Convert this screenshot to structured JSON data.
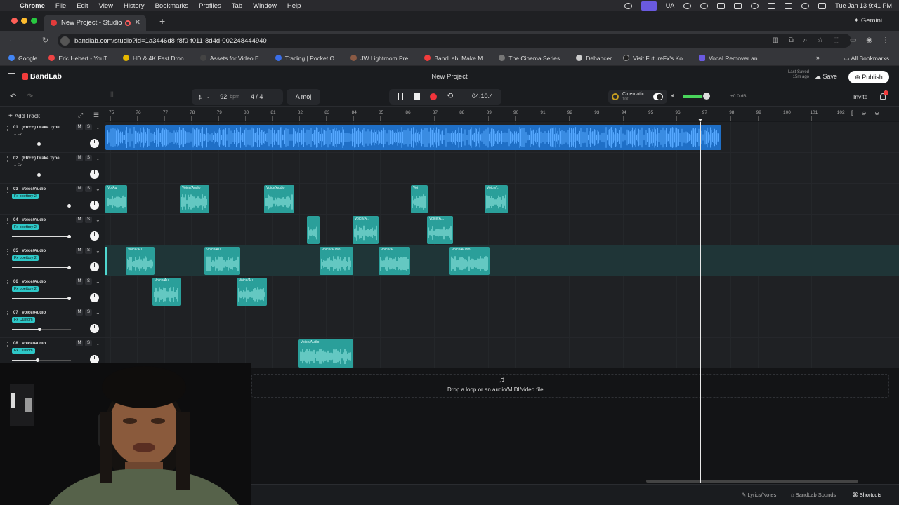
{
  "menubar": {
    "app": "Chrome",
    "items": [
      "File",
      "Edit",
      "View",
      "History",
      "Bookmarks",
      "Profiles",
      "Tab",
      "Window",
      "Help"
    ],
    "lang": "UA",
    "datetime": "Tue Jan 13  9:41 PM"
  },
  "browser": {
    "tab_title": "New Project - Studio",
    "gemini": "Gemini",
    "url": "bandlab.com/studio?id=1a3446d8-f8f0-f011-8d4d-002248444940",
    "bookmarks": [
      "Google",
      "Eric Hebert - YouT...",
      "HD & 4K Fast Dron...",
      "Assets for Video E...",
      "Trading | Pocket O...",
      "JW Lightroom Pre...",
      "BandLab: Make M...",
      "The Cinema Series...",
      "Dehancer",
      "Visit FutureFx's Ko...",
      "Vocal Remover an..."
    ],
    "all_bookmarks": "All Bookmarks"
  },
  "studio": {
    "brand": "BandLab",
    "project_title": "New Project",
    "last_saved": "Last Saved 15m ago",
    "save": "Save",
    "publish": "Publish",
    "invite": "Invite",
    "notif_count": "1"
  },
  "transport": {
    "bpm": "92",
    "bpm_unit": "bpm",
    "time_sig": "4 / 4",
    "key": "A moj",
    "timecode": "04:10.4",
    "preset_name": "Cinematic",
    "preset_value": "100",
    "master_db": "+0.0 dB",
    "master_level": 0.75
  },
  "tracks_panel": {
    "add_track": "Add Track"
  },
  "ruler": {
    "bars": [
      "75",
      "76",
      "77",
      "78",
      "79",
      "80",
      "81",
      "82",
      "83",
      "84",
      "85",
      "86",
      "87",
      "88",
      "89",
      "90",
      "91",
      "92",
      "93",
      "94",
      "95",
      "96",
      "97",
      "98",
      "99",
      "100",
      "101",
      "102"
    ]
  },
  "tracks": [
    {
      "num": "01",
      "name": "(FREE) Drake Type ...",
      "fx": "+ Fx",
      "fx_plain": true,
      "mute": "M",
      "solo": "S"
    },
    {
      "num": "02",
      "name": "(FREE) Drake Type ...",
      "fx": "+ Fx",
      "fx_plain": true,
      "mute": "M",
      "solo": "S"
    },
    {
      "num": "03",
      "name": "Voice/Audio",
      "fx": "Fx  poetboy 2",
      "fx_plain": false,
      "mute": "M",
      "solo": "S"
    },
    {
      "num": "04",
      "name": "Voice/Audio",
      "fx": "Fx  poetboy 2",
      "fx_plain": false,
      "mute": "M",
      "solo": "S"
    },
    {
      "num": "05",
      "name": "Voice/Audio",
      "fx": "Fx  poetboy 2",
      "fx_plain": false,
      "mute": "M",
      "solo": "S"
    },
    {
      "num": "06",
      "name": "Voice/Audio",
      "fx": "Fx  poetboy 2",
      "fx_plain": false,
      "mute": "M",
      "solo": "S"
    },
    {
      "num": "07",
      "name": "Voice/Audio",
      "fx": "Fx  Custom",
      "fx_plain": false,
      "mute": "M",
      "solo": "S"
    },
    {
      "num": "08",
      "name": "Voice/Audio",
      "fx": "Fx  Custom",
      "fx_plain": false,
      "mute": "M",
      "solo": "S"
    }
  ],
  "clip_labels": {
    "t3": [
      "Vo/Au",
      "Voice/Audio",
      "Voice/Audio",
      "Voi",
      "Voice/..."
    ],
    "t4": [
      "",
      "Voice/A...",
      "Voice/A..."
    ],
    "t5": [
      "Voice/Au...",
      "Voice/Au...",
      "Voice/Audio",
      "Voice/A...",
      "Voice/Audio"
    ],
    "t6": [
      "Voice/Au...",
      "Voice/Au..."
    ],
    "t8": [
      "Voice/Audio"
    ]
  },
  "dropzone": {
    "text": "Drop a loop or an audio/MIDI/video file"
  },
  "footer": {
    "lyrics": "Lyrics/Notes",
    "sounds": "BandLab Sounds",
    "shortcuts": "Shortcuts"
  }
}
